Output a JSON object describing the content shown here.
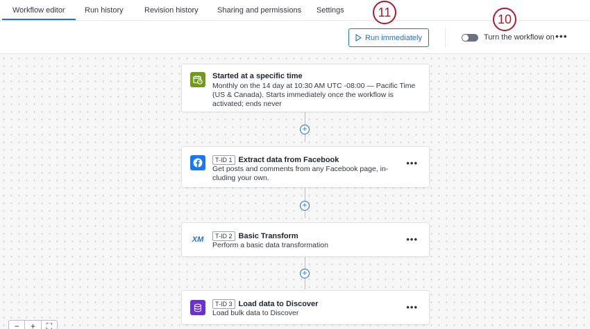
{
  "tabs": [
    {
      "label": "Workflow editor",
      "active": true
    },
    {
      "label": "Run history"
    },
    {
      "label": "Revision history"
    },
    {
      "label": "Sharing and permissions"
    },
    {
      "label": "Settings"
    }
  ],
  "toolbar": {
    "run_label": "Run immediately",
    "toggle_label": "Turn the workflow on",
    "toggle_on": false,
    "more_label": "•••"
  },
  "callouts": {
    "first": "11",
    "second": "10"
  },
  "trigger": {
    "icon": "calendar-clock-icon",
    "title": "Started at a specific time",
    "description": "Monthly on the 14 day at 10:30 AM UTC -08:00 — Pacific Time (US & Canada). Starts immediately once the workflow is activated; ends never"
  },
  "tasks": [
    {
      "icon": "facebook-icon",
      "tid": "T-ID 1",
      "title": "Extract data from Facebook",
      "description": "Get posts and comments from any Facebook page, in-cluding your own.",
      "more": "•••"
    },
    {
      "icon": "xm-icon",
      "icon_text": "XM",
      "tid": "T-ID 2",
      "title": "Basic Transform",
      "description": "Perform a basic data transformation",
      "more": "•••"
    },
    {
      "icon": "database-icon",
      "tid": "T-ID 3",
      "title": "Load data to Discover",
      "description": "Load bulk data to Discover",
      "more": "•••"
    }
  ],
  "add_step_label": "+",
  "zoom": {
    "out": "−",
    "in": "+",
    "fit": "⛶"
  },
  "colors": {
    "accent": "#1f6fd6",
    "callout": "#b0182d",
    "trigger_icon": "#6f9a1c",
    "facebook": "#1877f2",
    "discover": "#6b2fd6"
  }
}
